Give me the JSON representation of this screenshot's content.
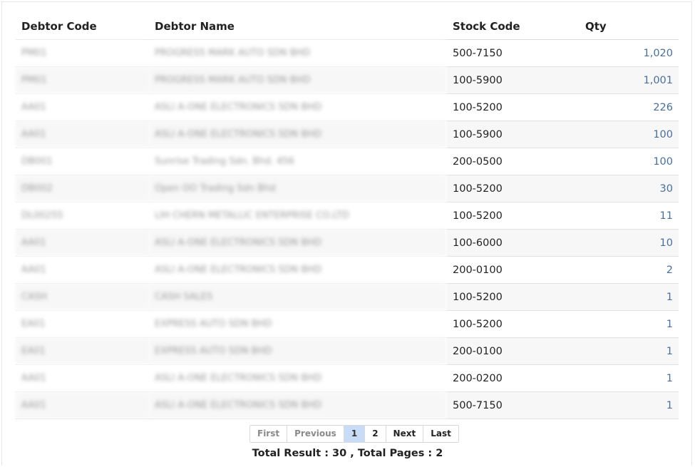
{
  "table": {
    "headers": {
      "debtor_code": "Debtor Code",
      "debtor_name": "Debtor Name",
      "stock_code": "Stock Code",
      "qty": "Qty"
    },
    "rows": [
      {
        "debtor_code": "PM01",
        "debtor_name": "PROGRESS MARK AUTO SDN BHD",
        "stock_code": "500-7150",
        "qty": "1,020"
      },
      {
        "debtor_code": "PM01",
        "debtor_name": "PROGRESS MARK AUTO SDN BHD",
        "stock_code": "100-5900",
        "qty": "1,001"
      },
      {
        "debtor_code": "AA01",
        "debtor_name": "ASLI A-ONE ELECTRONICS SDN BHD",
        "stock_code": "100-5200",
        "qty": "226"
      },
      {
        "debtor_code": "AA01",
        "debtor_name": "ASLI A-ONE ELECTRONICS SDN BHD",
        "stock_code": "100-5900",
        "qty": "100"
      },
      {
        "debtor_code": "DB001",
        "debtor_name": "Sunrise Trading Sdn. Bhd. 456",
        "stock_code": "200-0500",
        "qty": "100"
      },
      {
        "debtor_code": "DB002",
        "debtor_name": "Open OO Trading Sdn Bhd",
        "stock_code": "100-5200",
        "qty": "30"
      },
      {
        "debtor_code": "DL00255",
        "debtor_name": "LIH CHERN METALLIC ENTERPRISE CO.LTD",
        "stock_code": "100-5200",
        "qty": "11"
      },
      {
        "debtor_code": "AA01",
        "debtor_name": "ASLI A-ONE ELECTRONICS SDN BHD",
        "stock_code": "100-6000",
        "qty": "10"
      },
      {
        "debtor_code": "AA01",
        "debtor_name": "ASLI A-ONE ELECTRONICS SDN BHD",
        "stock_code": "200-0100",
        "qty": "2"
      },
      {
        "debtor_code": "CASH",
        "debtor_name": "CASH SALES",
        "stock_code": "100-5200",
        "qty": "1"
      },
      {
        "debtor_code": "EA01",
        "debtor_name": "EXPRESS AUTO SDN BHD",
        "stock_code": "100-5200",
        "qty": "1"
      },
      {
        "debtor_code": "EA01",
        "debtor_name": "EXPRESS AUTO SDN BHD",
        "stock_code": "200-0100",
        "qty": "1"
      },
      {
        "debtor_code": "AA01",
        "debtor_name": "ASLI A-ONE ELECTRONICS SDN BHD",
        "stock_code": "200-0200",
        "qty": "1"
      },
      {
        "debtor_code": "AA01",
        "debtor_name": "ASLI A-ONE ELECTRONICS SDN BHD",
        "stock_code": "500-7150",
        "qty": "1"
      }
    ]
  },
  "pagination": {
    "first": "First",
    "previous": "Previous",
    "pages": [
      "1",
      "2"
    ],
    "current_page": "1",
    "next": "Next",
    "last": "Last"
  },
  "summary": {
    "text": "Total Result : 30 , Total Pages : 2"
  },
  "colors": {
    "qty_text": "#4a6f99",
    "active_page_bg": "#c9dcf7",
    "row_alt_bg": "#f7f7f7"
  }
}
